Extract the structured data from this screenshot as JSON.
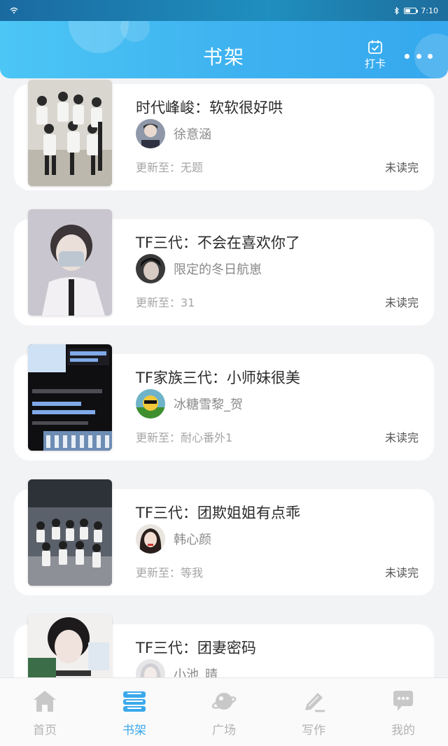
{
  "status_bar": {
    "time": "7:10"
  },
  "header": {
    "title": "书架",
    "checkin_label": "打卡"
  },
  "books": [
    {
      "title": "时代峰峻：软软很好哄",
      "author": "徐意涵",
      "update": "更新至：无题",
      "status": "未读完"
    },
    {
      "title": "TF三代：不会在喜欢你了",
      "author": "限定的冬日航崽",
      "update": "更新至：31",
      "status": "未读完"
    },
    {
      "title": "TF家族三代：小师妹很美",
      "author": "冰糖雪黎_贺",
      "update": "更新至：耐心番外1",
      "status": "未读完"
    },
    {
      "title": "TF三代：团欺姐姐有点乖",
      "author": "韩心颜",
      "update": "更新至：等我",
      "status": "未读完"
    },
    {
      "title": "TF三代：团妻密码",
      "author": "小池_晴",
      "update": "",
      "status": ""
    }
  ],
  "nav": [
    {
      "label": "首页",
      "icon": "home-icon"
    },
    {
      "label": "书架",
      "icon": "bookshelf-icon",
      "active": true
    },
    {
      "label": "广场",
      "icon": "planet-icon"
    },
    {
      "label": "写作",
      "icon": "pen-icon"
    },
    {
      "label": "我的",
      "icon": "chat-bubble-icon"
    }
  ],
  "colors": {
    "accent": "#3aa9ec",
    "header_start": "#4cc6f5",
    "header_end": "#35a8ee"
  }
}
